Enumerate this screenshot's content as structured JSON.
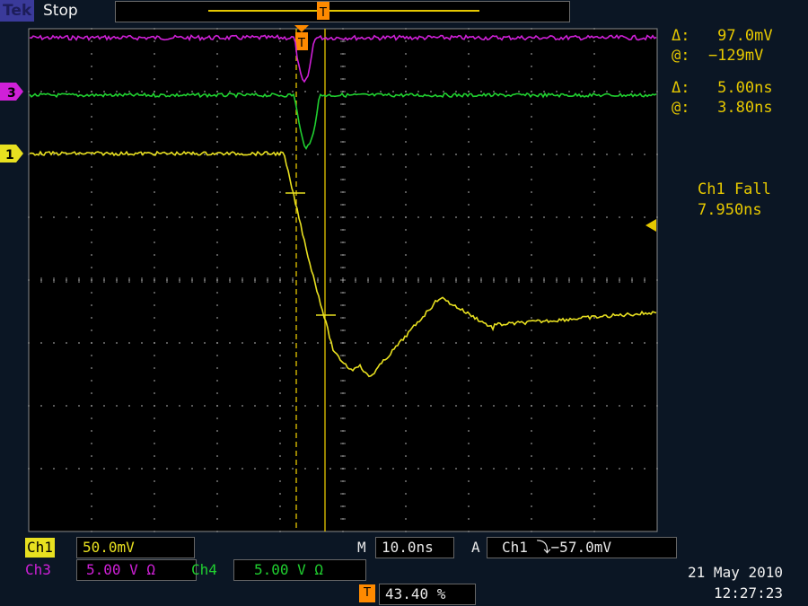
{
  "header": {
    "brand": "Tek",
    "status": "Stop"
  },
  "cursor_readout": {
    "amp_delta": "Δ:   97.0mV",
    "amp_at": "@:  −129mV",
    "time_delta": "Δ:   5.00ns",
    "time_at": "@:   3.80ns"
  },
  "measurement": {
    "label": "Ch1 Fall",
    "value": "7.950ns"
  },
  "markers": {
    "ch3": "3",
    "ch1": "1",
    "trigger": "T"
  },
  "channels": {
    "ch1_label": "Ch1",
    "ch1_scale": "50.0mV",
    "ch3_label": "Ch3",
    "ch3_scale": "5.00 V Ω",
    "ch4_label": "Ch4",
    "ch4_scale": "5.00 V Ω"
  },
  "timebase": {
    "label": "M",
    "value": "10.0ns"
  },
  "trigger": {
    "label": "A",
    "source": "Ch1",
    "level": "⤵−57.0mV",
    "position": "43.40 %"
  },
  "date": "21 May 2010",
  "time": "12:27:23",
  "colors": {
    "ch1": "#e8e020",
    "ch3": "#d020d8",
    "ch4": "#20d030",
    "grid": "#8a8a8a",
    "cursor": "#e6c800",
    "trigger_marker": "#ff8a00"
  }
}
